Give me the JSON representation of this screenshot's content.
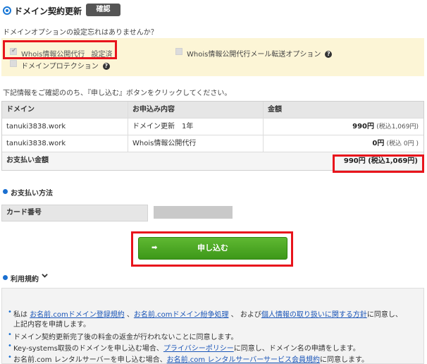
{
  "header": {
    "title": "ドメイン契約更新",
    "badge": "確認"
  },
  "options": {
    "question": "ドメインオプションの設定忘れはありませんか？",
    "whois": "Whois情報公開代行",
    "whois_status": "設定済",
    "whois_mail": "Whois情報公開代行メール転送オプション",
    "protection": "ドメインプロテクション",
    "help_glyph": "?"
  },
  "instruction": "下記情報をご確認ののち、『申し込む』ボタンをクリックしてください。",
  "table": {
    "headers": [
      "ドメイン",
      "お申込み内容",
      "金額"
    ],
    "rows": [
      {
        "domain": "tanuki3838.work",
        "content": "ドメイン更新　1年",
        "amount": "990円",
        "tax": "(税込1,069円)"
      },
      {
        "domain": "tanuki3838.work",
        "content": "Whois情報公開代行",
        "amount": "0円",
        "tax": "(税込 0円 )"
      }
    ],
    "total_label": "お支払い金額",
    "total_amount": "990円 (税込1,069円)"
  },
  "payment": {
    "section_title": "お支払い方法",
    "card_label": "カード番号"
  },
  "apply_button": {
    "label": "申し込む",
    "icon": "arrow-right"
  },
  "terms": {
    "section_title": "利用規約",
    "line1": {
      "pre": "私は ",
      "link1": "お名前.comドメイン登録規約",
      "sep1": " 、",
      "link2": "お名前.comドメイン紛争処理",
      "sep2": " 、 および",
      "link3": "個人情報の取り扱いに関する方針",
      "post": "に同意し、"
    },
    "line1b": "上記内容を申請します。",
    "line2": "ドメイン契約更新完了後の料金の返金が行われないことに同意します。",
    "line3": {
      "pre": "Key-systems取扱のドメインを申し込む場合、",
      "link": "プライバシーポリシー",
      "post": "に同意し、ドメイン名の申請をします。"
    },
    "line4": {
      "pre": "お名前.com レンタルサーバーを申し込む場合、",
      "link": "お名前.com レンタルサーバーサービス会員規約",
      "post": "に同意します。"
    }
  },
  "colors": {
    "accent": "#1a78d6",
    "highlight": "#e8141c",
    "button": "#4caa24",
    "options_bg": "#fcf5d6"
  }
}
